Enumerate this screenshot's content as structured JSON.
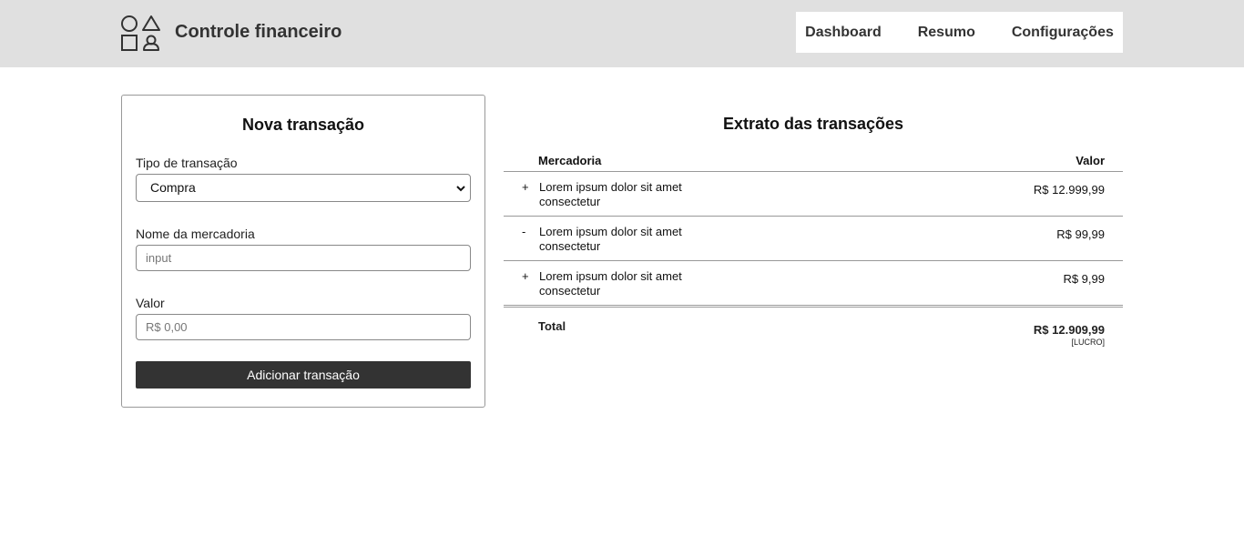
{
  "header": {
    "app_title": "Controle financeiro",
    "logo_icon": "shapes-logo-icon",
    "bg_color": "#e0e0e0",
    "nav": [
      {
        "label": "Dashboard"
      },
      {
        "label": "Resumo"
      },
      {
        "label": "Configurações"
      }
    ]
  },
  "form": {
    "title": "Nova transação",
    "type_label": "Tipo de transação",
    "type_selected": "Compra",
    "name_label": "Nome da mercadoria",
    "name_placeholder": "input",
    "value_label": "Valor",
    "value_placeholder": "R$ 0,00",
    "submit_label": "Adicionar transação",
    "button_color": "#333333"
  },
  "ledger": {
    "title": "Extrato das transações",
    "col_name": "Mercadoria",
    "col_value": "Valor",
    "rows": [
      {
        "sign": "+",
        "description": "Lorem ipsum dolor sit amet consectetur",
        "value": "R$ 12.999,99"
      },
      {
        "sign": "-",
        "description": "Lorem ipsum dolor sit amet consectetur",
        "value": "R$ 99,99"
      },
      {
        "sign": "+",
        "description": "Lorem ipsum dolor sit amet consectetur",
        "value": "R$ 9,99"
      }
    ],
    "total_label": "Total",
    "total_value": "R$ 12.909,99",
    "total_status": "[LUCRO]"
  }
}
